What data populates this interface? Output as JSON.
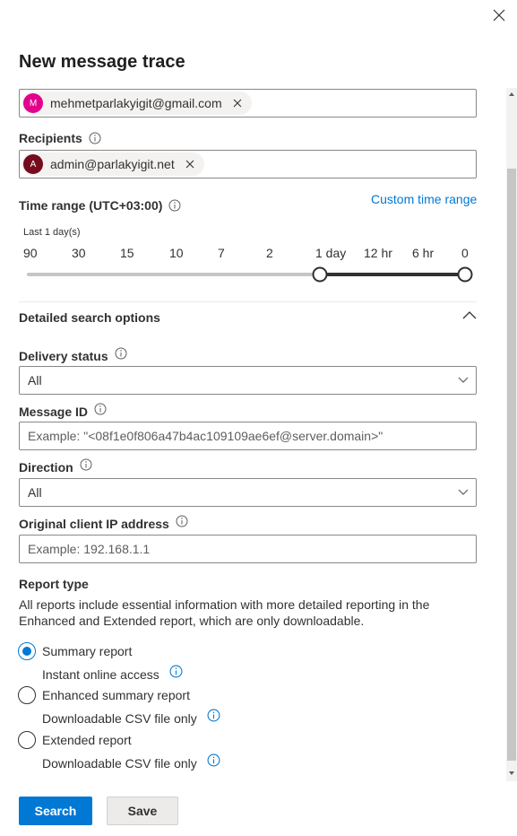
{
  "panel": {
    "title": "New message trace"
  },
  "senders": {
    "items": [
      {
        "initial": "M",
        "email": "mehmetparlakyigit@gmail.com",
        "color": "#e3008c"
      }
    ]
  },
  "recipients": {
    "label": "Recipients",
    "items": [
      {
        "initial": "A",
        "email": "admin@parlakyigit.net",
        "color": "#750b1c"
      }
    ]
  },
  "time_range": {
    "label": "Time range (UTC+03:00)",
    "custom_link": "Custom time range",
    "current_text": "Last 1 day(s)",
    "ticks": [
      "90",
      "30",
      "15",
      "10",
      "7",
      "2",
      "1 day",
      "12 hr",
      "6 hr",
      "0"
    ],
    "selected_start": "1 day",
    "selected_end": "0"
  },
  "detailed": {
    "title": "Detailed search options",
    "delivery_status": {
      "label": "Delivery status",
      "value": "All"
    },
    "message_id": {
      "label": "Message ID",
      "placeholder": "Example: \"<08f1e0f806a47b4ac109109ae6ef@server.domain>\""
    },
    "direction": {
      "label": "Direction",
      "value": "All"
    },
    "client_ip": {
      "label": "Original client IP address",
      "placeholder": "Example: 192.168.1.1"
    }
  },
  "report_type": {
    "label": "Report type",
    "description": "All reports include essential information with more detailed reporting in the Enhanced and Extended report, which are only downloadable.",
    "options": [
      {
        "label": "Summary report",
        "sub": "Instant online access",
        "checked": true
      },
      {
        "label": "Enhanced summary report",
        "sub": "Downloadable CSV file only",
        "checked": false
      },
      {
        "label": "Extended report",
        "sub": "Downloadable CSV file only",
        "checked": false
      }
    ]
  },
  "actions": {
    "search_label": "Search",
    "save_label": "Save"
  },
  "colors": {
    "accent": "#0078d4",
    "text": "#323130"
  }
}
